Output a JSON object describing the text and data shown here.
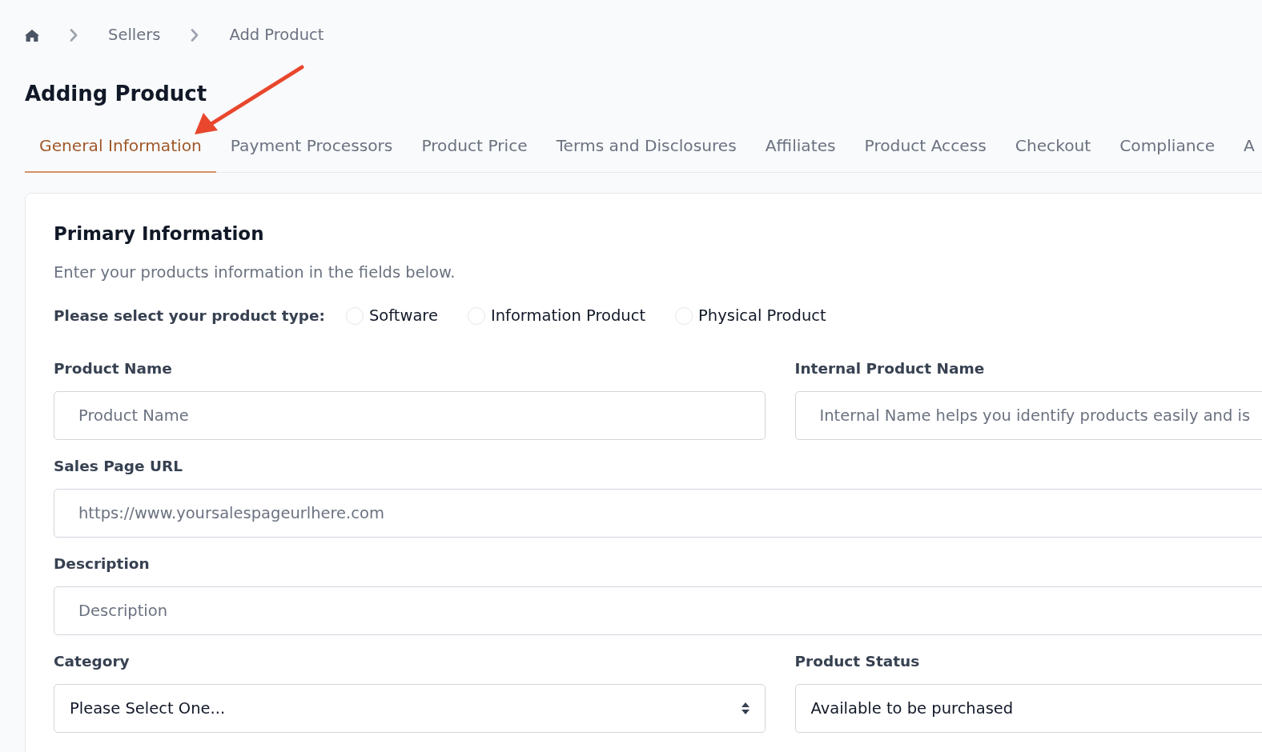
{
  "breadcrumb": [
    "Sellers",
    "Add Product"
  ],
  "page_title": "Adding Product",
  "tabs": [
    {
      "label": "General Information",
      "selected": true
    },
    {
      "label": "Payment Processors",
      "selected": false
    },
    {
      "label": "Product Price",
      "selected": false
    },
    {
      "label": "Terms and Disclosures",
      "selected": false
    },
    {
      "label": "Affiliates",
      "selected": false
    },
    {
      "label": "Product Access",
      "selected": false
    },
    {
      "label": "Checkout",
      "selected": false
    },
    {
      "label": "Compliance",
      "selected": false
    },
    {
      "label": "A",
      "selected": false
    }
  ],
  "section": {
    "title": "Primary Information",
    "subtitle": "Enter your products information in the fields below.",
    "product_type": {
      "label": "Please select your product type:",
      "options": [
        {
          "label": "Software",
          "selected": false
        },
        {
          "label": "Information Product",
          "selected": false
        },
        {
          "label": "Physical Product",
          "selected": false
        }
      ]
    },
    "rows": [
      [
        {
          "kind": "text",
          "label": "Product Name",
          "placeholder": "Product Name"
        },
        {
          "kind": "text",
          "label": "Internal Product Name",
          "placeholder": "Internal Name helps you identify products easily and is"
        }
      ],
      [
        {
          "kind": "text",
          "label": "Sales Page URL",
          "placeholder": "https://www.yoursalespageurlhere.com"
        }
      ],
      [
        {
          "kind": "text",
          "label": "Description",
          "placeholder": "Description"
        }
      ],
      [
        {
          "kind": "select",
          "label": "Category",
          "value": "Please Select One..."
        },
        {
          "kind": "select",
          "label": "Product Status",
          "value": "Available to be purchased"
        }
      ]
    ]
  }
}
